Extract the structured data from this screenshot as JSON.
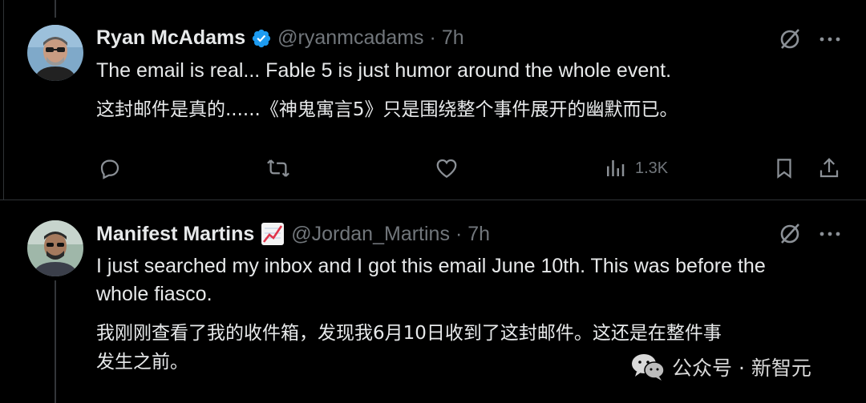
{
  "tweets": [
    {
      "name": "Ryan McAdams",
      "handle": "@ryanmcadams",
      "separator": "·",
      "time": "7h",
      "text_en": "The email is real... Fable 5 is just humor around the whole event.",
      "text_zh": "这封邮件是真的......《神鬼寓言5》只是围绕整个事件展开的幽默而已。",
      "views": "1.3K",
      "verified_color": "#1d9bf0"
    },
    {
      "name": "Manifest Martins",
      "handle": "@Jordan_Martins",
      "separator": "·",
      "time": "7h",
      "text_en_line1": "I just searched my inbox and I got this email June 10th. This was before the",
      "text_en_line2": "whole fiasco.",
      "text_zh_line1": "我刚刚查看了我的收件箱，发现我6月10日收到了这封邮件。这还是在整件事",
      "text_zh_line2": "发生之前。",
      "badge_emoji": "chart-increasing-icon"
    }
  ],
  "watermark": {
    "text": "公众号 · 新智元"
  },
  "colors": {
    "background": "#000000",
    "text_primary": "#e7e9ea",
    "text_secondary": "#71767b",
    "divider": "#2f3336"
  }
}
